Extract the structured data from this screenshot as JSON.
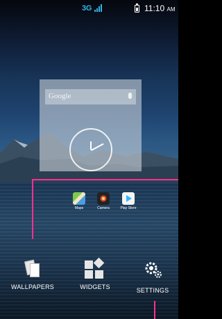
{
  "status_bar": {
    "network": "3G",
    "time": "11:10",
    "ampm": "AM"
  },
  "preview": {
    "search_label": "Google"
  },
  "apps": [
    {
      "label": "Maps"
    },
    {
      "label": "Camera"
    },
    {
      "label": "Play Store"
    }
  ],
  "actions": {
    "wallpapers": "WALLPAPERS",
    "widgets": "WIDGETS",
    "settings": "SETTINGS"
  },
  "colors": {
    "accent_network": "#33b5e5",
    "guide_line": "#ff2f92"
  }
}
